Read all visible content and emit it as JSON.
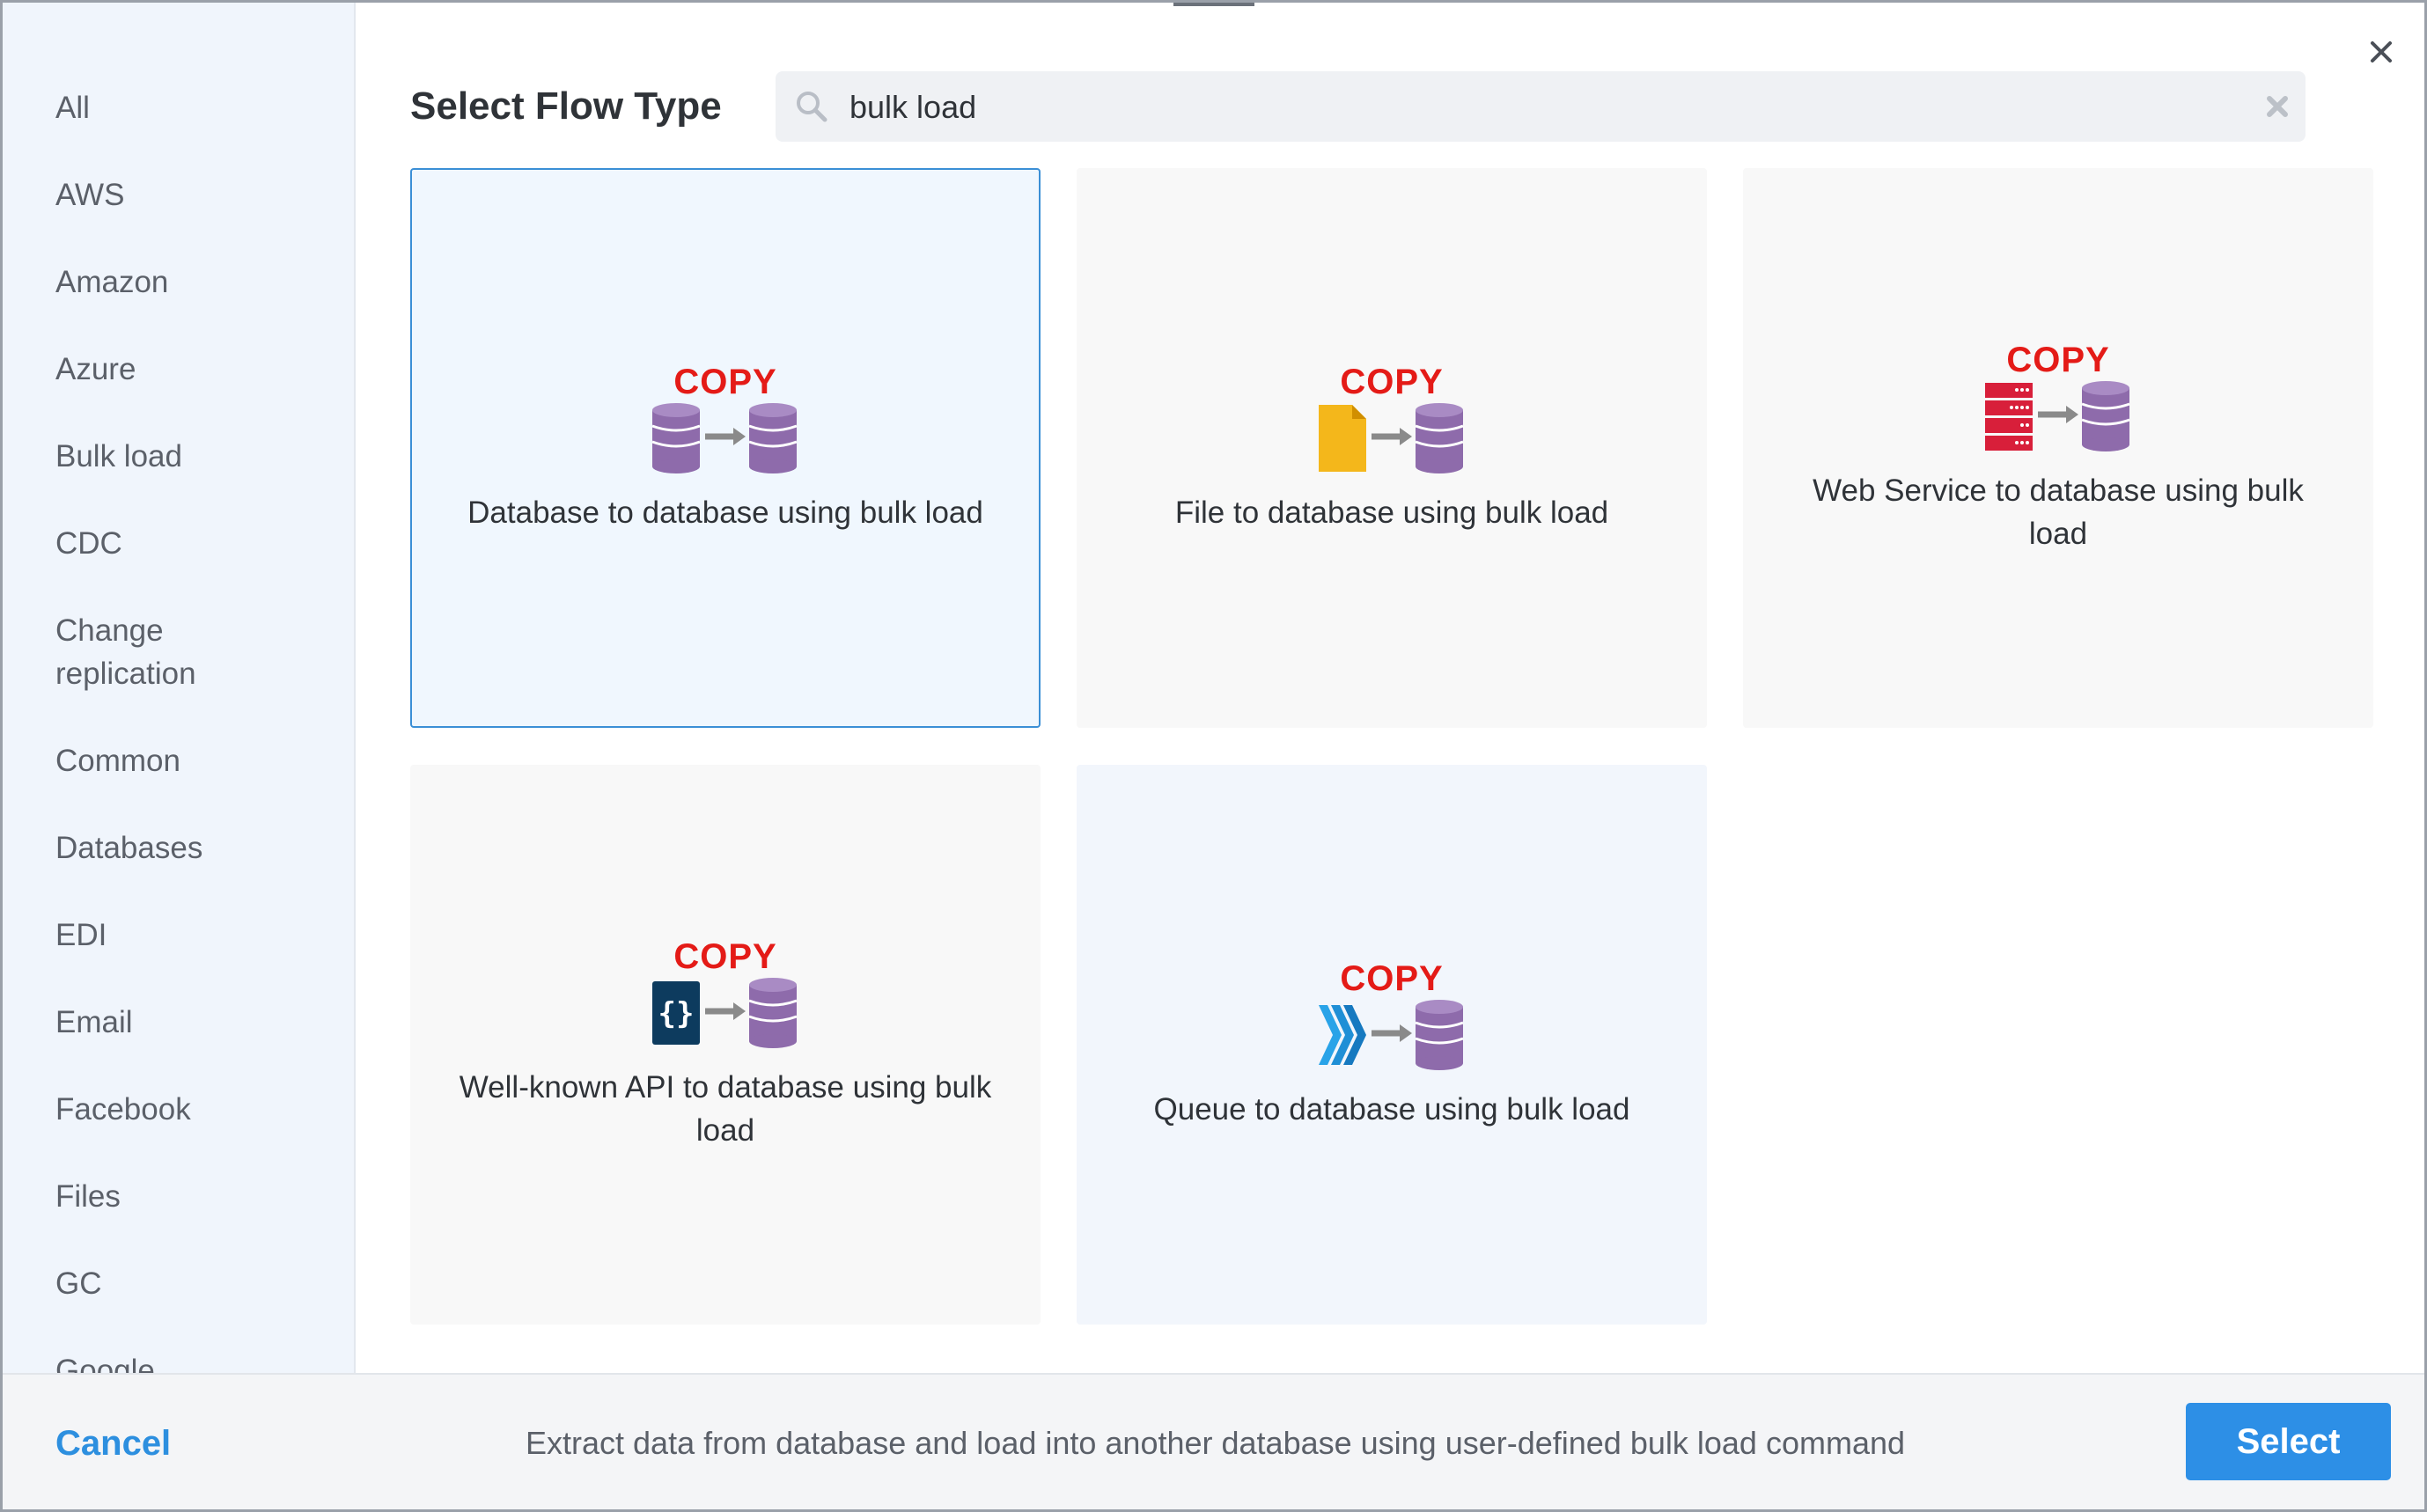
{
  "dialog": {
    "title": "Select Flow Type",
    "search": {
      "value": "bulk load",
      "placeholder": ""
    }
  },
  "sidebar": {
    "items": [
      {
        "label": "All"
      },
      {
        "label": "AWS"
      },
      {
        "label": "Amazon"
      },
      {
        "label": "Azure"
      },
      {
        "label": "Bulk load"
      },
      {
        "label": "CDC"
      },
      {
        "label": "Change replication"
      },
      {
        "label": "Common"
      },
      {
        "label": "Databases"
      },
      {
        "label": "EDI"
      },
      {
        "label": "Email"
      },
      {
        "label": "Facebook"
      },
      {
        "label": "Files"
      },
      {
        "label": "GC"
      },
      {
        "label": "Google"
      }
    ]
  },
  "cards": [
    {
      "copy_label": "COPY",
      "label": "Database to database using bulk load",
      "source_icon": "database-icon",
      "state": "selected"
    },
    {
      "copy_label": "COPY",
      "label": "File to database using bulk load",
      "source_icon": "file-icon",
      "state": "default"
    },
    {
      "copy_label": "COPY",
      "label": "Web Service to database using bulk load",
      "source_icon": "server-icon",
      "state": "default"
    },
    {
      "copy_label": "COPY",
      "label": "Well-known API to database using bulk load",
      "source_icon": "api-braces-icon",
      "state": "default"
    },
    {
      "copy_label": "COPY",
      "label": "Queue to database using bulk load",
      "source_icon": "queue-icon",
      "state": "hover"
    }
  ],
  "footer": {
    "cancel_label": "Cancel",
    "description": "Extract data from database and load into another database using user-defined bulk load command",
    "select_label": "Select"
  },
  "colors": {
    "accent": "#2d8fe6",
    "copy_red": "#e41b17",
    "database_purple": "#8e6bab",
    "selected_border": "#3b8fd6"
  }
}
